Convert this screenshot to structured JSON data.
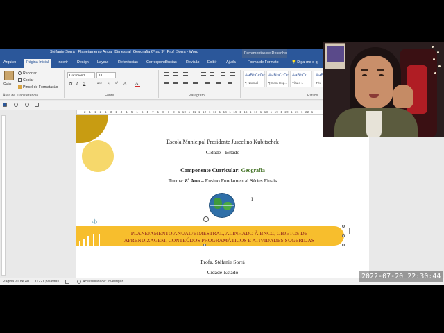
{
  "window": {
    "title": "Stéfanie Sorrá _Planejamento Anual_Bimestral_Geografia 6º ao 9º_Prof_Sorra  -  Word",
    "contextual_tools": "Ferramentas de Desenho"
  },
  "tabs": [
    {
      "label": "Arquivo"
    },
    {
      "label": "Página Inicial",
      "active": true
    },
    {
      "label": "Inserir"
    },
    {
      "label": "Design"
    },
    {
      "label": "Layout"
    },
    {
      "label": "Referências"
    },
    {
      "label": "Correspondências"
    },
    {
      "label": "Revisão"
    },
    {
      "label": "Exibir"
    },
    {
      "label": "Ajuda"
    },
    {
      "label": "Forma de Formato"
    }
  ],
  "tellme": "Diga-me o q",
  "ribbon": {
    "paste_label": "Colar",
    "cut_label": "Recortar",
    "copy_label": "Copiar",
    "format_painter_label": "Pincel de Formatação",
    "clipboard_group": "Área de Transferência",
    "font_name": "Garamond",
    "font_size": "18",
    "font_group": "Fonte",
    "paragraph_group": "Parágrafo",
    "styles_group": "Estilos",
    "styles": [
      {
        "sample": "AaBbCcDc",
        "name": "¶ Normal"
      },
      {
        "sample": "AaBbCcDc",
        "name": "¶ Sem Esp..."
      },
      {
        "sample": "AaBbCc",
        "name": "Título 1"
      },
      {
        "sample": "AaB",
        "name": "Títu"
      }
    ]
  },
  "ruler": {
    "numbers": "2 · 1 · 1 · 2 · 1 · 3 · 1 · 4 · 1 · 5 · 1 · 6 · 1 · 7 · 1 · 8 · 1 · 9 · 1 ·10· 1 ·11· 1 ·12· 1 ·13· 1 ·14· 1 ·15· 1 ·16· 1 ·17· 1 ·18· 1 ·19· 1 ·20· 1 ·21· 1 ·22· 1"
  },
  "document": {
    "school": "Escola Municipal Presidente Juscelino Kubitschek",
    "city_state": "Cidade - Estado",
    "component_label": "Componente Curricular",
    "component_value": "Geografia",
    "class_label": "Turma:",
    "class_grade": "8º Ano –",
    "class_rest": " Ensino Fundamental Séries Finais",
    "banner_line1": "PLANEJAMENTO ANUAL/BIMESTRAL, ALINHADO À BNCC, OBJETOS DE",
    "banner_line2": "APRENDIZAGEM, CONTEÚDOS PROGRAMÁTICOS E ATIVIDADES SUGERIDAS",
    "teacher": "Profa. Stéfanie Sorrá",
    "city": "Cidade-Estado"
  },
  "status": {
    "page": "Página 21 de 40",
    "words": "11221 palavras",
    "accessibility": "Acessibilidade: investigar"
  },
  "timestamp": "2022-07-20  22:30:44",
  "colors": {
    "word_blue": "#2b579a",
    "banner_yellow": "#f7be2d",
    "banner_text": "#8a1b1b",
    "deco_gold": "#c89c12",
    "deco_light": "#f6d86b",
    "component_green": "#3a6b1b"
  }
}
